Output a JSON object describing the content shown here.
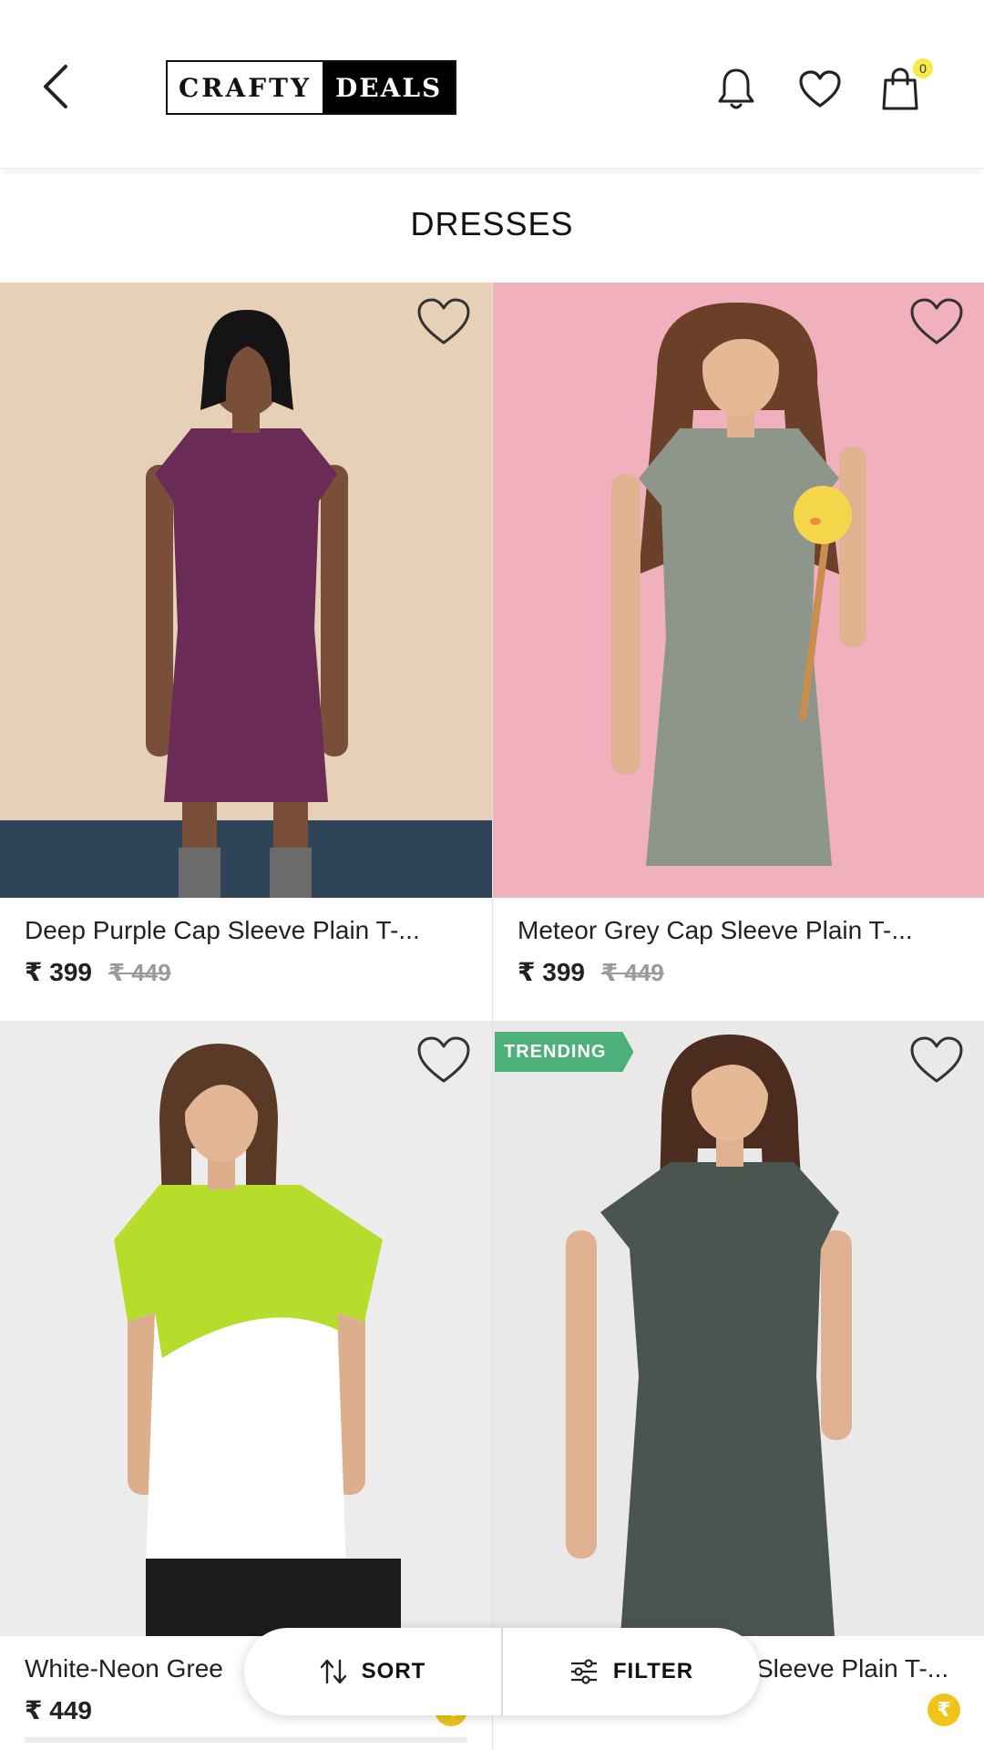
{
  "header": {
    "brand_left": "CRAFTY",
    "brand_right": "DEALS",
    "cart_count": "0",
    "icons": [
      "chevron-left-icon",
      "bell-icon",
      "heart-icon",
      "shopping-bag-icon"
    ]
  },
  "page": {
    "title": "DRESSES"
  },
  "products": [
    {
      "name": "Deep Purple Cap Sleeve Plain T-...",
      "price": "₹ 399",
      "mrp": "₹ 449",
      "badge": "",
      "color": "#6b2b57",
      "bg": "#e8d2bb"
    },
    {
      "name": "Meteor Grey Cap Sleeve Plain T-...",
      "price": "₹ 399",
      "mrp": "₹ 449",
      "badge": "",
      "color": "#8e968b",
      "bg": "#f1b0bd"
    },
    {
      "name": "White-Neon Gree",
      "price": "₹ 449",
      "mrp": "",
      "badge": "",
      "color": "#ffffff",
      "bg": "#ececec"
    },
    {
      "name": "Sleeve Plain T-...",
      "price": "",
      "mrp": "",
      "badge": "TRENDING",
      "color": "#4a5550",
      "bg": "#e9e9ea"
    }
  ],
  "actions": {
    "sort_label": "SORT",
    "filter_label": "FILTER"
  },
  "colors": {
    "accent_green": "#4cb078",
    "coin": "#f0c419",
    "badge_yellow": "#f7e94a"
  }
}
